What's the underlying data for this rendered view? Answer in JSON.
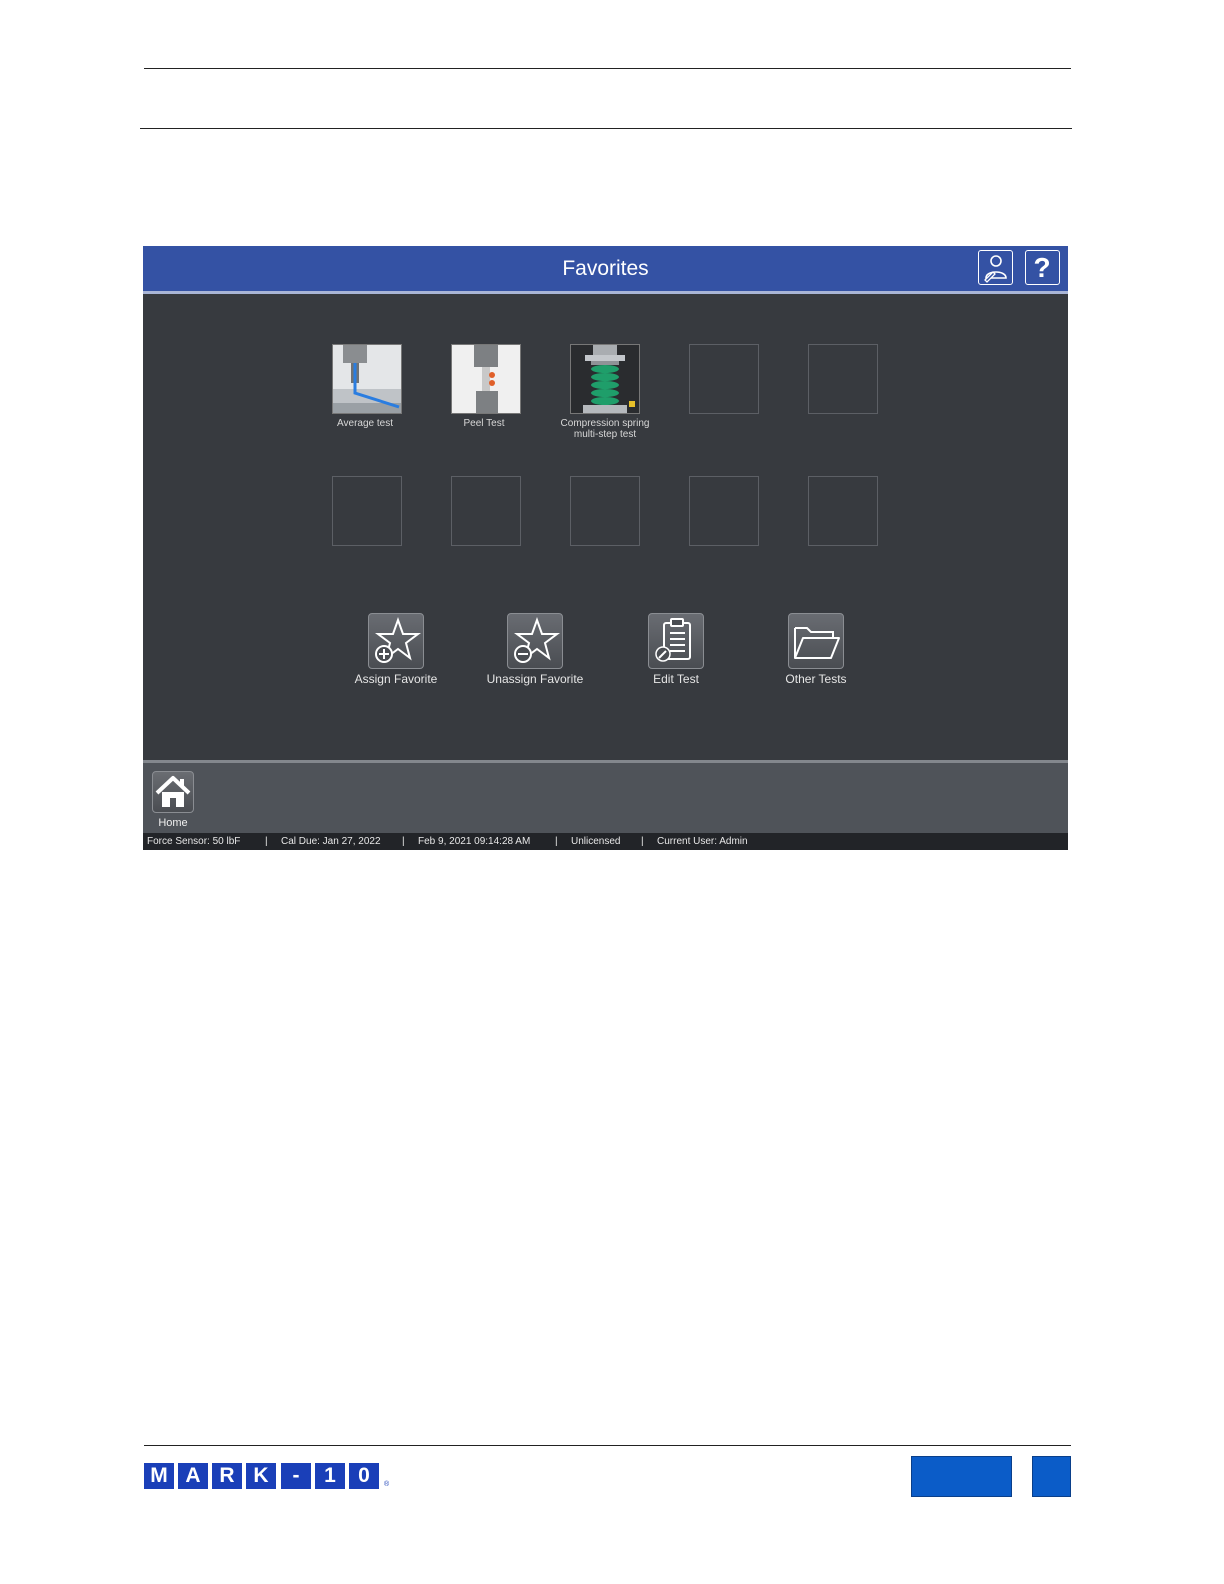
{
  "screen": {
    "title": "Favorites",
    "header_buttons": {
      "user_icon": "user-edit-icon",
      "help_icon": "help-icon",
      "help_glyph": "?"
    },
    "favorites": [
      {
        "label": "Average test",
        "icon": "average-test-thumbnail"
      },
      {
        "label": "Peel Test",
        "icon": "peel-test-thumbnail"
      },
      {
        "label": "Compression spring multi-step test",
        "icon": "compression-spring-thumbnail"
      }
    ],
    "actions": [
      {
        "label": "Assign Favorite",
        "icon": "star-plus-icon"
      },
      {
        "label": "Unassign Favorite",
        "icon": "star-minus-icon"
      },
      {
        "label": "Edit Test",
        "icon": "clipboard-edit-icon"
      },
      {
        "label": "Other Tests",
        "icon": "folder-open-icon"
      }
    ],
    "home_label": "Home",
    "status": {
      "sensor": "Force Sensor: 50 lbF",
      "cal_due": "Cal Due: Jan 27, 2022",
      "datetime": "Feb 9, 2021 09:14:28 AM",
      "license": "Unlicensed",
      "user": "Current User: Admin",
      "separator": "|"
    }
  },
  "logo": {
    "letters": [
      "M",
      "A",
      "R",
      "K",
      "-",
      "1",
      "0"
    ],
    "reg": "®"
  },
  "colors": {
    "header_blue": "#3452a4",
    "screen_bg": "#373a3f",
    "logo_blue": "#1a3fb8",
    "page_box_blue": "#0b5cc8"
  }
}
